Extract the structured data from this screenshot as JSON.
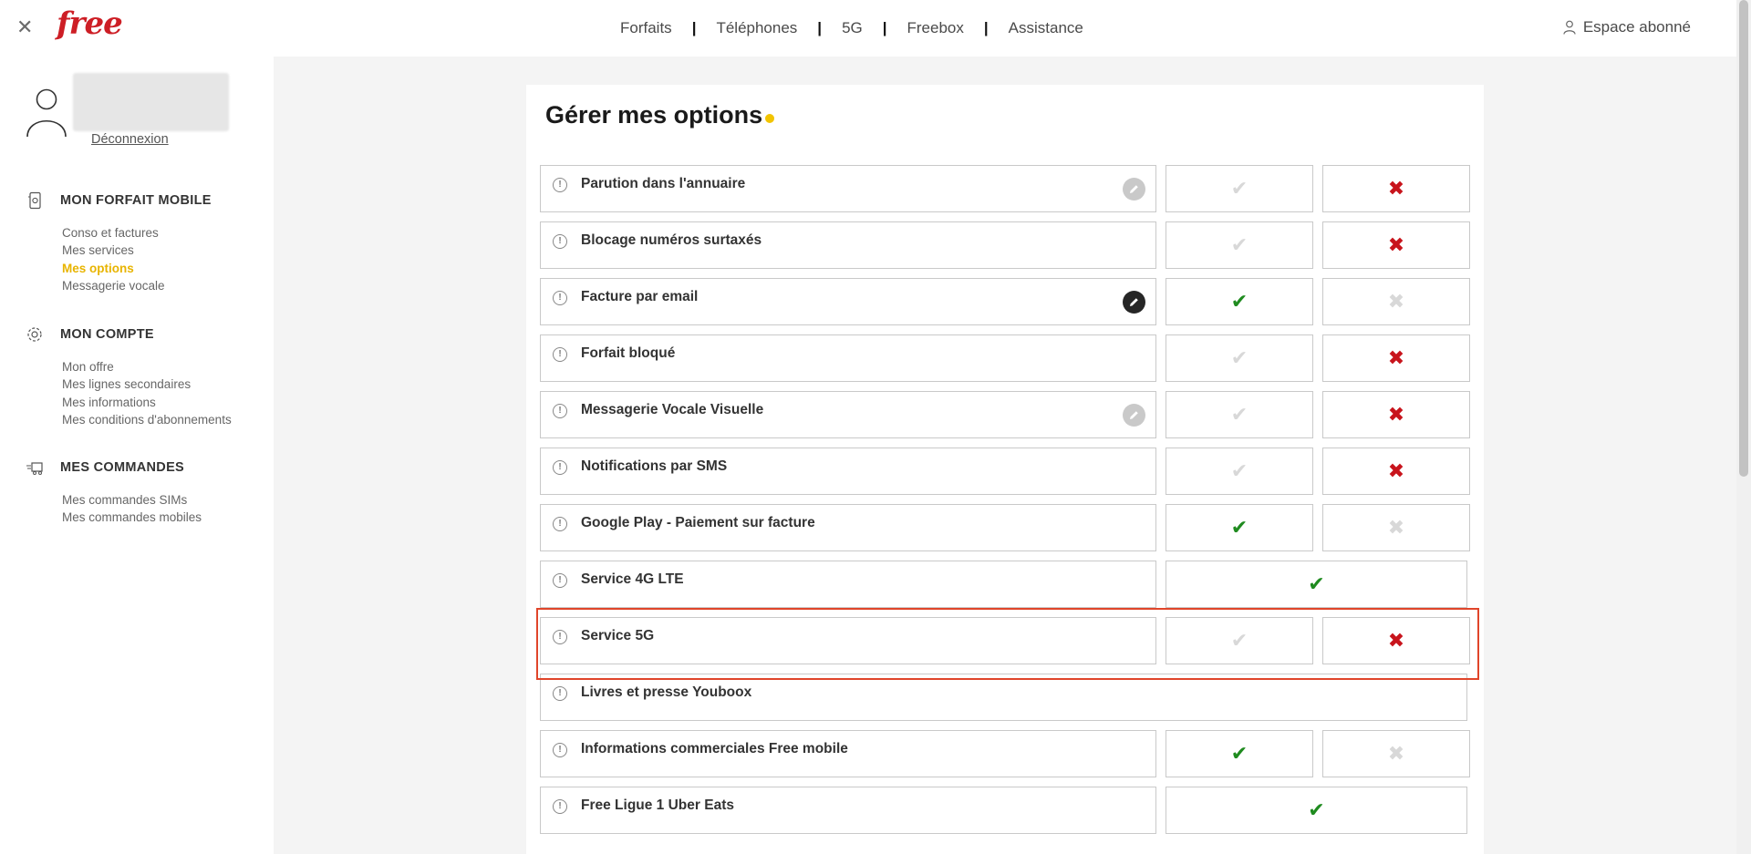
{
  "topbar": {
    "close_icon": "close-icon",
    "logo": "free",
    "nav": [
      "Forfaits",
      "Téléphones",
      "5G",
      "Freebox",
      "Assistance"
    ],
    "nav_separator": "|",
    "account_label": "Espace abonné"
  },
  "sidebar": {
    "logout_label": "Déconnexion",
    "sections": [
      {
        "title": "MON FORFAIT MOBILE",
        "icon": "phone-icon",
        "links": [
          "Conso et factures",
          "Mes services",
          "Mes options",
          "Messagerie vocale"
        ],
        "active": "Mes options"
      },
      {
        "title": "MON COMPTE",
        "icon": "gear-icon",
        "links": [
          "Mon offre",
          "Mes lignes secondaires",
          "Mes informations",
          "Mes conditions d'abonnements"
        ]
      },
      {
        "title": "MES COMMANDES",
        "icon": "delivery-truck-icon",
        "links": [
          "Mes commandes SIMs",
          "Mes commandes mobiles"
        ]
      }
    ]
  },
  "main": {
    "title_prefix": "Gérer",
    "title_bold": "mes options",
    "accent_color": "#f2c400",
    "options": [
      {
        "label": "Parution dans l'annuaire",
        "edit": "light",
        "state": "off"
      },
      {
        "label": "Blocage numéros surtaxés",
        "state": "off"
      },
      {
        "label": "Facture par email",
        "edit": "dark",
        "state": "on"
      },
      {
        "label": "Forfait bloqué",
        "state": "off"
      },
      {
        "label": "Messagerie Vocale Visuelle",
        "edit": "light",
        "state": "off"
      },
      {
        "label": "Notifications par SMS",
        "state": "off"
      },
      {
        "label": "Google Play - Paiement sur facture",
        "state": "on"
      },
      {
        "label": "Service 4G LTE",
        "state": "single-on"
      },
      {
        "label": "Service 5G",
        "state": "off",
        "highlighted": true
      },
      {
        "label": "Livres et presse Youboox",
        "state": "none"
      },
      {
        "label": "Informations commerciales Free mobile",
        "state": "on"
      },
      {
        "label": "Free Ligue 1 Uber Eats",
        "state": "single-on"
      }
    ],
    "check_glyph": "✔",
    "cross_glyph": "✖",
    "info_glyph": "!"
  },
  "colors": {
    "brand_red": "#cd1e25",
    "active_link": "#e8b400",
    "check_green": "#1f8b1f",
    "cross_red": "#c8141c",
    "highlight": "#e0452a"
  }
}
